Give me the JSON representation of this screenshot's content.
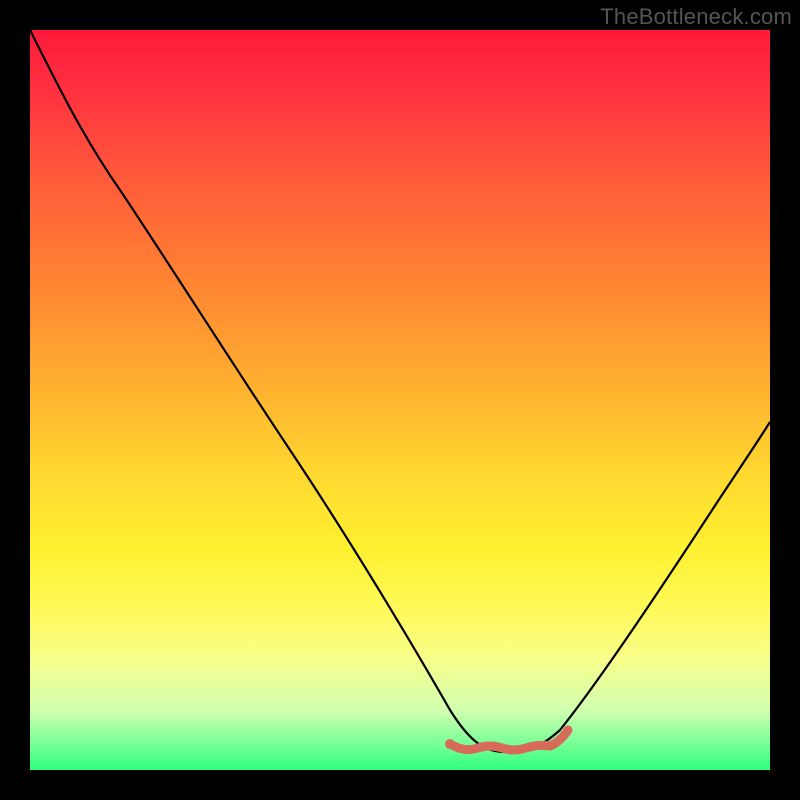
{
  "watermark": "TheBottleneck.com",
  "colors": {
    "background": "#000000",
    "curve": "#000000",
    "squiggle": "#d86a5a",
    "gradient_top": "#ff1a3a",
    "gradient_bottom": "#30ff80"
  },
  "chart_data": {
    "type": "line",
    "title": "",
    "xlabel": "",
    "ylabel": "",
    "xlim": [
      0,
      100
    ],
    "ylim": [
      0,
      100
    ],
    "grid": false,
    "legend": false,
    "note": "Axes are unlabeled; values are read off relative position in the 740×740 plot area (0 = left/bottom, 100 = right/top). Higher y = top of chart.",
    "x": [
      0,
      5,
      12,
      20,
      28,
      36,
      44,
      52,
      57,
      60,
      64,
      68,
      72,
      80,
      90,
      100
    ],
    "y": [
      100,
      90,
      80,
      68,
      56,
      44,
      32,
      18,
      8,
      3,
      2,
      3,
      6,
      18,
      36,
      56
    ],
    "valley_marker": {
      "x_range": [
        58,
        73
      ],
      "y": 3,
      "description": "short red horizontal squiggle marking the optimal zone at the curve minimum"
    }
  }
}
